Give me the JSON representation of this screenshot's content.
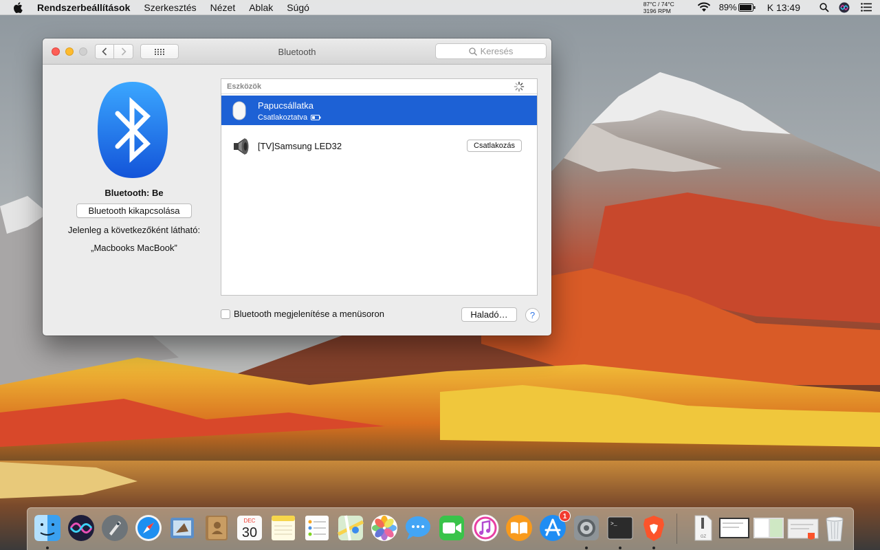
{
  "menubar": {
    "app_name": "Rendszerbeállítások",
    "menus": [
      "Szerkesztés",
      "Nézet",
      "Ablak",
      "Súgó"
    ],
    "cpu_temps": "87°C / 74°C",
    "cpu_freq": "3196 RPM",
    "battery_percent": "89%",
    "clock": "K 13:49"
  },
  "window": {
    "title": "Bluetooth",
    "search_placeholder": "Keresés",
    "bluetooth_status": "Bluetooth: Be",
    "toggle_button": "Bluetooth kikapcsolása",
    "visible_as_label": "Jelenleg a következőként látható:",
    "device_name": "„Macbooks MacBook”",
    "devices": {
      "header": "Eszközök",
      "items": [
        {
          "name": "Papucsállatka",
          "status": "Csatlakoztatva",
          "icon": "mouse-icon",
          "selected": true
        },
        {
          "name": "[TV]Samsung LED32",
          "action": "Csatlakozás",
          "icon": "speaker-icon",
          "selected": false
        }
      ]
    },
    "show_in_menubar": "Bluetooth megjelenítése a menüsoron",
    "show_in_menubar_checked": false,
    "advanced_button": "Haladó…",
    "help": "?"
  },
  "dock": {
    "calendar_month": "DEC",
    "calendar_day": "30",
    "app_store_badge": "1",
    "items": [
      "finder-icon",
      "siri-icon",
      "launchpad-icon",
      "safari-icon",
      "mail-icon",
      "contacts-icon",
      "calendar-icon",
      "notes-icon",
      "reminders-icon",
      "maps-icon",
      "photos-icon",
      "messages-icon",
      "facetime-icon",
      "itunes-icon",
      "ibooks-icon",
      "app-store-icon",
      "system-preferences-icon",
      "terminal-icon",
      "brave-icon",
      "archive-icon",
      "window-thumbnail-icon",
      "window-thumbnail-icon",
      "window-thumbnail-icon",
      "trash-icon"
    ]
  },
  "colors": {
    "accent": "#1d61d5",
    "bluetooth_blue": "#1a7af2",
    "close": "#fd5f57",
    "minimize": "#febb2e"
  }
}
